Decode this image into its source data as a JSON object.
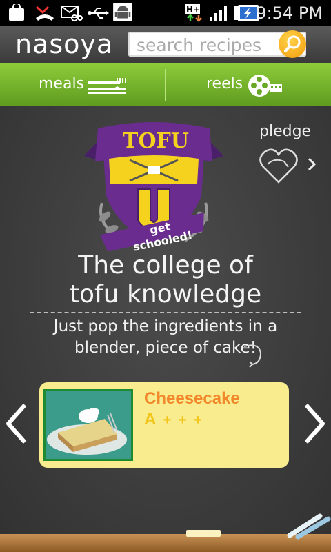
{
  "status_bar": {
    "time": "9:54 PM",
    "network": "H+"
  },
  "header": {
    "logo": "nasoya",
    "search_placeholder": "search recipes"
  },
  "nav": {
    "tabs": [
      {
        "label": "meals",
        "icon": "utensils-icon"
      },
      {
        "label": "reels",
        "icon": "film-reel-icon"
      }
    ]
  },
  "crest": {
    "top_text": "TOFU",
    "letter": "U",
    "ribbon_text": "get schooled!"
  },
  "pledge": {
    "label": "pledge"
  },
  "headline": {
    "line1": "The college of",
    "line2": "tofu knowledge"
  },
  "subline": {
    "line1": "Just pop the ingredients in a",
    "line2": "blender, piece of cake!"
  },
  "recipe_card": {
    "title": "Cheesecake",
    "grade": "A",
    "plus_marks": [
      "+",
      "+",
      "+"
    ]
  },
  "colors": {
    "nav_green": "#7cbf2e",
    "card_yellow": "#f8ec8e",
    "title_orange": "#f2882a",
    "crest_purple": "#6a2c8f",
    "crest_gold": "#f5d21e"
  }
}
